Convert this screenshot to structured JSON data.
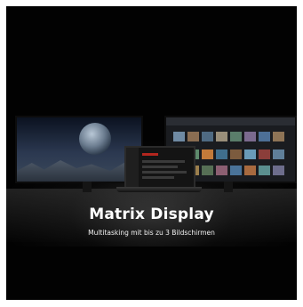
{
  "banner": {
    "title": "Matrix Display",
    "subtitle": "Multitasking mit bis zu 3 Bildschirmen"
  },
  "colors": {
    "background": "#020202",
    "frame_border": "#ffffff",
    "text": "#ffffff",
    "accent": "#b3261e"
  },
  "devices": [
    "left-monitor",
    "laptop",
    "right-monitor"
  ]
}
